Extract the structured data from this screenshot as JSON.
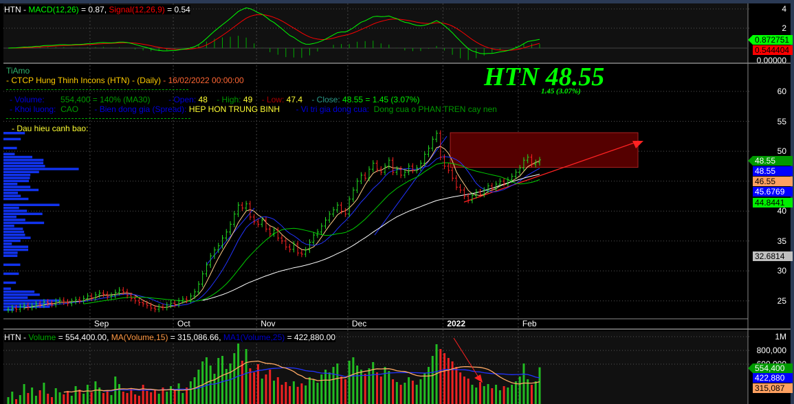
{
  "symbol": "HTN",
  "macd_panel": {
    "prefix": "HTN - ",
    "macd_label": "MACD(12,26)",
    "macd_value": " = 0.87, ",
    "signal_label": "Signal(12,26,9)",
    "signal_value": " = 0.54",
    "axis_ticks": [
      "4",
      "2",
      "0.00000"
    ],
    "macd_tag": "0.872751",
    "signal_tag": "0.544404",
    "colors": {
      "macd": "#00ff00",
      "signal": "#ff0000"
    }
  },
  "info": {
    "author": "TiAmo",
    "company": "- CTCP Hung Thinh Incons (HTN) - (Daily)",
    "datetime": "- 16/02/2022 00:00:00",
    "volume_label": "- Volume:",
    "volume_value": "554,400  =  140%  (MA30)",
    "open_label": "- Open:",
    "open_value": "48",
    "high_label": "- High:",
    "high_value": "49",
    "low_label": "- Low:",
    "low_value": "47.4",
    "close_label": "- Close:",
    "close_value": "48.55  =  1.45  (3.07%)",
    "khoi_label": "- Khoi luong:",
    "khoi_value": "CAO",
    "spread_label": "-   Bien dong gia (Spread):",
    "spread_value": "HEP HON TRUNG BINH",
    "vitri_label": "-   Vi tri gia dong cua:",
    "vitri_value": "Dong cua o PHAN TREN cay nen",
    "warning": "- Dau hieu canh bao:"
  },
  "headline": {
    "title": "HTN 48.55",
    "change": "1.45 (3.07%)"
  },
  "price_axis": {
    "ticks": [
      "60",
      "55",
      "50",
      "45",
      "40",
      "35",
      "30",
      "25"
    ],
    "tags": [
      {
        "text": "48.55",
        "bg": "#009900",
        "fg": "#ffffff"
      },
      {
        "text": "48.55",
        "bg": "#0000ff",
        "fg": "#ffffff"
      },
      {
        "text": "46.55",
        "bg": "#ffa060",
        "fg": "#000000"
      },
      {
        "text": "45.6769",
        "bg": "#0000ff",
        "fg": "#ffffff"
      },
      {
        "text": "44.8441",
        "bg": "#00ee00",
        "fg": "#000000"
      },
      {
        "text": "32.6814",
        "bg": "#c0c0c0",
        "fg": "#000000"
      }
    ]
  },
  "volume_panel": {
    "prefix": "HTN - ",
    "vol_label": "Volume",
    "vol_value": " = 554,400.00, ",
    "ma_label": "MA(Volume,15)",
    "ma_value": " = 315,086.66, ",
    "ma1_label": "MA1(Volume,25)",
    "ma1_value": " = 422,880.00",
    "axis_ticks": [
      "1M",
      "800,000",
      "600,000"
    ],
    "tags": [
      {
        "text": "554,400",
        "bg": "#009900",
        "fg": "#ffffff"
      },
      {
        "text": "422,880",
        "bg": "#0000ff",
        "fg": "#ffffff"
      },
      {
        "text": "315,087",
        "bg": "#ffa060",
        "fg": "#000000"
      }
    ]
  },
  "chart_data": {
    "type": "candlestick",
    "x_labels": [
      {
        "label": "Sep",
        "index": 22
      },
      {
        "label": "Oct",
        "index": 43
      },
      {
        "label": "Nov",
        "index": 64
      },
      {
        "label": "Dec",
        "index": 87
      },
      {
        "label": "2022",
        "index": 111
      },
      {
        "label": "Feb",
        "index": 130
      }
    ],
    "ylim": [
      22,
      62
    ],
    "close": [
      23.5,
      23.8,
      23.6,
      24,
      24.2,
      23.9,
      24.1,
      24.5,
      24.3,
      24.8,
      24.6,
      24.4,
      24.9,
      25.1,
      24.8,
      24.6,
      24.9,
      25.2,
      25,
      25.4,
      25.8,
      25.5,
      26,
      26.3,
      26.1,
      25.7,
      25.9,
      26.4,
      26.8,
      26.5,
      25.9,
      25.4,
      25,
      24.7,
      24.5,
      24.2,
      23.8,
      23.6,
      24,
      23.9,
      24.3,
      24.6,
      24.4,
      25,
      25.3,
      25.1,
      25.8,
      26.5,
      27.8,
      29.5,
      31,
      32.5,
      33.5,
      34.2,
      35.5,
      36.5,
      37.8,
      39.5,
      41,
      40.5,
      41.2,
      39,
      38.2,
      37.8,
      38.5,
      37,
      36.2,
      36.8,
      35.5,
      35,
      34,
      33.6,
      34.5,
      33,
      32.8,
      33.5,
      34.8,
      36,
      36.5,
      37.5,
      38.5,
      39.5,
      40.2,
      41,
      40,
      39.5,
      42,
      43.5,
      45,
      46,
      45.5,
      47,
      48,
      47,
      46.5,
      47.5,
      48.5,
      46.5,
      47,
      46,
      46.5,
      47.5,
      46.8,
      47.2,
      48,
      49.5,
      50.5,
      52,
      53,
      49,
      47.5,
      46.8,
      45.5,
      44,
      43.5,
      42.5,
      41.8,
      42.6,
      43.2,
      42.8,
      43.5,
      44.2,
      43.8,
      44.5,
      45,
      44.6,
      45.2,
      45.8,
      46.5,
      47.2,
      48.5,
      49,
      47.8,
      48.1,
      48.55
    ],
    "volume": [
      120,
      200,
      90,
      150,
      310,
      180,
      260,
      140,
      220,
      330,
      170,
      120,
      250,
      190,
      160,
      210,
      140,
      280,
      230,
      170,
      300,
      190,
      350,
      260,
      180,
      220,
      150,
      420,
      310,
      200,
      180,
      250,
      160,
      140,
      300,
      210,
      190,
      230,
      170,
      260,
      200,
      280,
      240,
      320,
      180,
      260,
      350,
      410,
      520,
      640,
      700,
      580,
      460,
      690,
      720,
      530,
      610,
      760,
      900,
      650,
      820,
      540,
      480,
      600,
      390,
      450,
      520,
      360,
      410,
      300,
      340,
      280,
      350,
      270,
      320,
      290,
      410,
      380,
      330,
      450,
      520,
      480,
      560,
      610,
      420,
      380,
      650,
      700,
      580,
      520,
      460,
      540,
      630,
      480,
      420,
      560,
      500,
      380,
      340,
      300,
      330,
      410,
      360,
      300,
      380,
      470,
      560,
      720,
      890,
      820,
      760,
      690,
      640,
      560,
      480,
      420,
      390,
      300,
      260,
      340,
      280,
      310,
      250,
      300,
      220,
      280,
      260,
      300,
      350,
      420,
      610,
      380,
      300,
      350,
      554.4
    ],
    "series": [
      {
        "name": "MA(Volume,15)"
      },
      {
        "name": "MA1(Volume,25)"
      }
    ]
  }
}
